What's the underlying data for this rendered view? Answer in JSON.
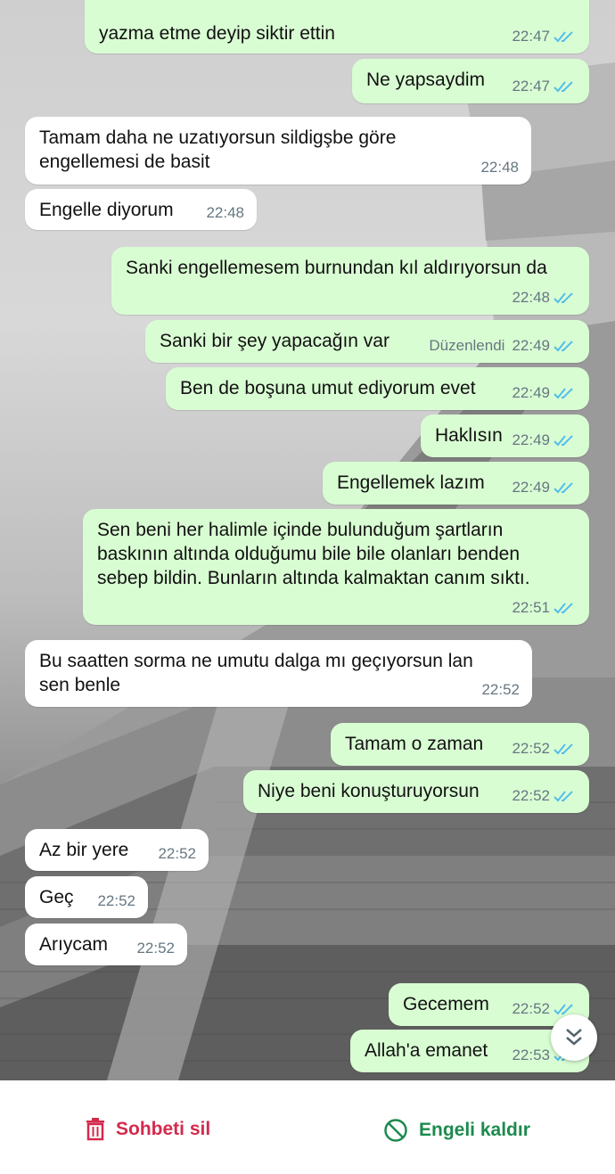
{
  "messages": [
    {
      "dir": "out",
      "text": "yazma etme deyip siktir ettin",
      "time": "22:47",
      "read": true
    },
    {
      "dir": "out",
      "text": "Ne yapsaydim",
      "time": "22:47",
      "read": true
    },
    {
      "dir": "in",
      "text": "Tamam daha ne uzatıyorsun sildigşbe göre\nengellemesi de basit",
      "time": "22:48"
    },
    {
      "dir": "in",
      "text": "Engelle diyorum",
      "time": "22:48"
    },
    {
      "dir": "out",
      "text": "Sanki engellemesem burnundan kıl aldırıyorsun da",
      "time": "22:48",
      "read": true
    },
    {
      "dir": "out",
      "text": "Sanki bir şey yapacağın var",
      "time": "22:49",
      "edited": "Düzenlendi",
      "read": true
    },
    {
      "dir": "out",
      "text": "Ben de boşuna umut ediyorum evet",
      "time": "22:49",
      "read": true
    },
    {
      "dir": "out",
      "text": "Haklısın",
      "time": "22:49",
      "read": true
    },
    {
      "dir": "out",
      "text": "Engellemek lazım",
      "time": "22:49",
      "read": true
    },
    {
      "dir": "out",
      "text": "Sen beni her halimle içinde bulunduğum şartların\nbaskının altında olduğumu bile bile olanları benden\nsebep bildin. Bunların altında kalmaktan canım sıktı.",
      "time": "22:51",
      "read": true
    },
    {
      "dir": "in",
      "text": "Bu saatten sorma ne umutu dalga mı geçıyorsun lan\nsen benle",
      "time": "22:52"
    },
    {
      "dir": "out",
      "text": "Tamam o zaman",
      "time": "22:52",
      "read": true
    },
    {
      "dir": "out",
      "text": "Niye beni konuşturuyorsun",
      "time": "22:52",
      "read": true
    },
    {
      "dir": "in",
      "text": "Az bir yere",
      "time": "22:52"
    },
    {
      "dir": "in",
      "text": "Geç",
      "time": "22:52"
    },
    {
      "dir": "in",
      "text": "Arıycam",
      "time": "22:52"
    },
    {
      "dir": "out",
      "text": "Gecemem",
      "time": "22:52",
      "read": true
    },
    {
      "dir": "out",
      "text": "Allah'a emanet",
      "time": "22:53",
      "read": true
    }
  ],
  "actions": {
    "delete_chat": "Sohbeti sil",
    "unblock": "Engeli kaldır"
  },
  "colors": {
    "outgoing_bubble": "#d9fdd3",
    "incoming_bubble": "#ffffff",
    "read_ticks": "#53bdeb",
    "delete_red": "#d42a4c",
    "unblock_green": "#1d8a4e"
  },
  "icons": {
    "delete": "trash-icon",
    "unblock": "block-circle-icon",
    "scroll": "double-chevron-down-icon"
  }
}
